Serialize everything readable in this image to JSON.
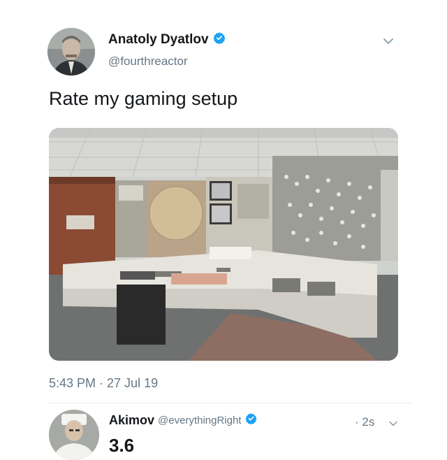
{
  "tweet": {
    "author": {
      "display_name": "Anatoly Dyatlov",
      "handle": "@fourthreactor",
      "verified": true
    },
    "text": "Rate my gaming setup",
    "timestamp": "5:43 PM · 27 Jul 19",
    "media": {
      "kind": "photo",
      "subject": "control-room-console"
    }
  },
  "reply": {
    "author": {
      "display_name": "Akimov",
      "handle": "@everythingRight",
      "verified": true
    },
    "time": "· 2s",
    "text": "3.6"
  },
  "icons": {
    "verified": "verified-badge-icon",
    "more": "chevron-down-icon"
  },
  "colors": {
    "verified_blue": "#1da1f2",
    "secondary_text": "#657786",
    "primary_text": "#14171a"
  }
}
